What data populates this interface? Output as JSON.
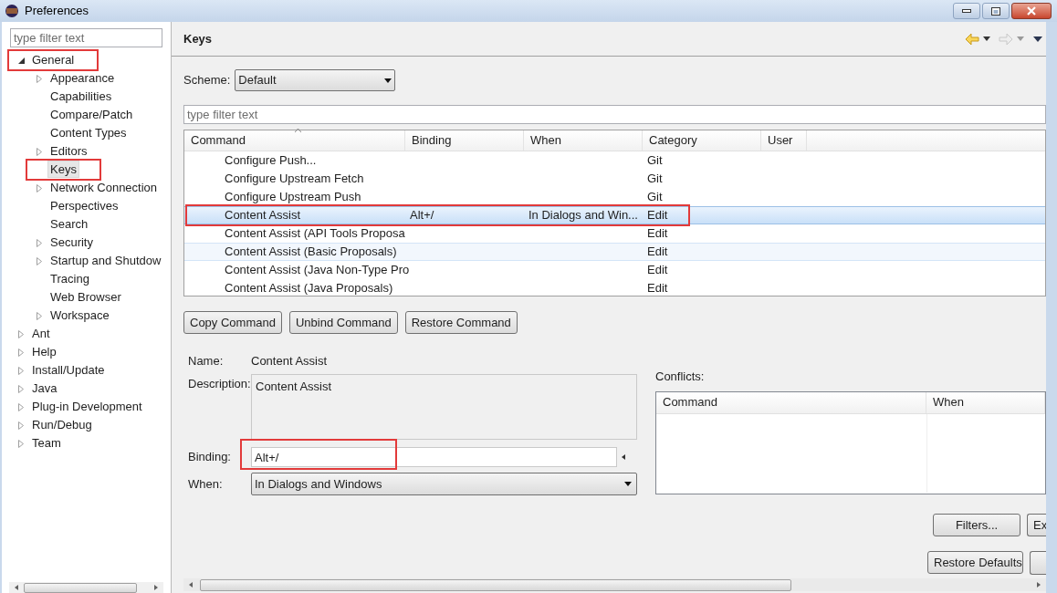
{
  "window": {
    "title": "Preferences"
  },
  "sidebar": {
    "filter": {
      "placeholder": "type filter text"
    },
    "tree": [
      {
        "label": "General",
        "kind": "folder",
        "expanded": true,
        "selected": false,
        "highlighted": true,
        "children": [
          {
            "label": "Appearance",
            "kind": "folder",
            "expanded": false,
            "selected": false,
            "highlighted": false
          },
          {
            "label": "Capabilities",
            "kind": "leaf",
            "selected": false,
            "highlighted": false
          },
          {
            "label": "Compare/Patch",
            "kind": "leaf",
            "selected": false,
            "highlighted": false
          },
          {
            "label": "Content Types",
            "kind": "leaf",
            "selected": false,
            "highlighted": false
          },
          {
            "label": "Editors",
            "kind": "folder",
            "expanded": false,
            "selected": false,
            "highlighted": false
          },
          {
            "label": "Keys",
            "kind": "leaf",
            "selected": true,
            "highlighted": true
          },
          {
            "label": "Network Connection",
            "kind": "folder",
            "expanded": false,
            "selected": false,
            "highlighted": false
          },
          {
            "label": "Perspectives",
            "kind": "leaf",
            "selected": false,
            "highlighted": false
          },
          {
            "label": "Search",
            "kind": "leaf",
            "selected": false,
            "highlighted": false
          },
          {
            "label": "Security",
            "kind": "folder",
            "expanded": false,
            "selected": false,
            "highlighted": false
          },
          {
            "label": "Startup and Shutdow",
            "kind": "folder",
            "expanded": false,
            "selected": false,
            "highlighted": false
          },
          {
            "label": "Tracing",
            "kind": "leaf",
            "selected": false,
            "highlighted": false
          },
          {
            "label": "Web Browser",
            "kind": "leaf",
            "selected": false,
            "highlighted": false
          },
          {
            "label": "Workspace",
            "kind": "folder",
            "expanded": false,
            "selected": false,
            "highlighted": false
          }
        ]
      },
      {
        "label": "Ant",
        "kind": "folder",
        "expanded": false,
        "selected": false,
        "highlighted": false
      },
      {
        "label": "Help",
        "kind": "folder",
        "expanded": false,
        "selected": false,
        "highlighted": false
      },
      {
        "label": "Install/Update",
        "kind": "folder",
        "expanded": false,
        "selected": false,
        "highlighted": false
      },
      {
        "label": "Java",
        "kind": "folder",
        "expanded": false,
        "selected": false,
        "highlighted": false
      },
      {
        "label": "Plug-in Development",
        "kind": "folder",
        "expanded": false,
        "selected": false,
        "highlighted": false
      },
      {
        "label": "Run/Debug",
        "kind": "folder",
        "expanded": false,
        "selected": false,
        "highlighted": false
      },
      {
        "label": "Team",
        "kind": "folder",
        "expanded": false,
        "selected": false,
        "highlighted": false
      }
    ]
  },
  "page": {
    "title": "Keys",
    "scheme": {
      "label": "Scheme:",
      "value": "Default"
    },
    "filter": {
      "placeholder": "type filter text"
    },
    "table": {
      "columns": [
        {
          "label": "Command",
          "sorted": true
        },
        {
          "label": "Binding",
          "sorted": false
        },
        {
          "label": "When",
          "sorted": false
        },
        {
          "label": "Category",
          "sorted": false
        },
        {
          "label": "User",
          "sorted": false
        }
      ],
      "rows": [
        {
          "command": "Configure Push...",
          "category": "Git",
          "selected": false,
          "hovered": false,
          "highlighted": false
        },
        {
          "command": "Configure Upstream Fetch",
          "category": "Git",
          "selected": false,
          "hovered": false,
          "highlighted": false
        },
        {
          "command": "Configure Upstream Push",
          "category": "Git",
          "selected": false,
          "hovered": false,
          "highlighted": false
        },
        {
          "command": "Content Assist",
          "binding": "Alt+/",
          "when": "In Dialogs and Win...",
          "category": "Edit",
          "selected": true,
          "hovered": false,
          "highlighted": true
        },
        {
          "command": "Content Assist (API Tools Proposa",
          "category": "Edit",
          "selected": false,
          "hovered": false,
          "highlighted": false
        },
        {
          "command": "Content Assist (Basic Proposals)",
          "category": "Edit",
          "selected": false,
          "hovered": true,
          "highlighted": false
        },
        {
          "command": "Content Assist (Java Non-Type Pro",
          "category": "Edit",
          "selected": false,
          "hovered": false,
          "highlighted": false
        },
        {
          "command": "Content Assist (Java Proposals)",
          "category": "Edit",
          "selected": false,
          "hovered": false,
          "highlighted": false
        }
      ]
    },
    "buttons": [
      "Copy Command",
      "Unbind Command",
      "Restore Command"
    ],
    "details": {
      "name": {
        "label": "Name:",
        "value": "Content Assist"
      },
      "description": {
        "label": "Description:",
        "value": "Content Assist"
      },
      "binding": {
        "label": "Binding:",
        "value": "Alt+/",
        "highlighted": true
      },
      "when": {
        "label": "When:",
        "value": "In Dialogs and Windows"
      }
    },
    "conflicts": {
      "label": "Conflicts:",
      "columns": [
        "Command",
        "When"
      ]
    },
    "side_buttons": [
      "Filters...",
      "Ex"
    ],
    "footer_buttons": [
      "Restore Defaults"
    ]
  }
}
